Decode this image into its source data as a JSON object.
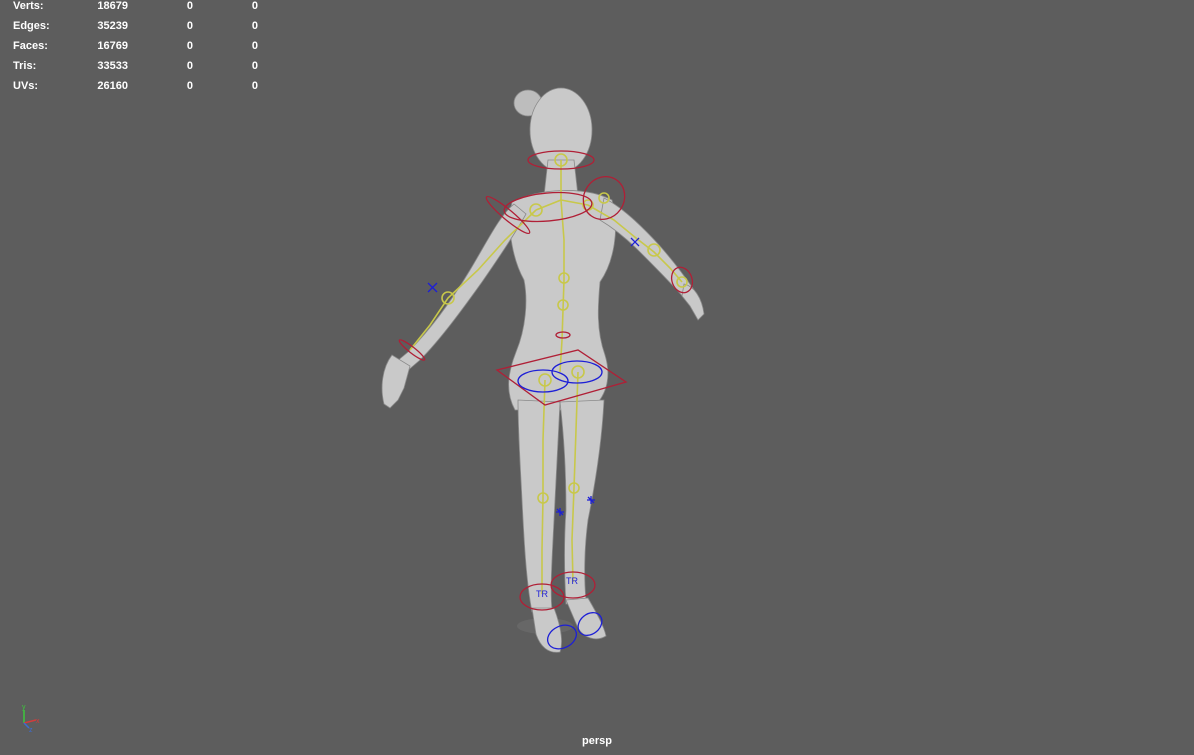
{
  "hud": {
    "rows": [
      {
        "label": "Verts:",
        "values": [
          "18679",
          "0",
          "0"
        ]
      },
      {
        "label": "Edges:",
        "values": [
          "35239",
          "0",
          "0"
        ]
      },
      {
        "label": "Faces:",
        "values": [
          "16769",
          "0",
          "0"
        ]
      },
      {
        "label": "Tris:",
        "values": [
          "33533",
          "0",
          "0"
        ]
      },
      {
        "label": "UVs:",
        "values": [
          "26160",
          "0",
          "0"
        ]
      }
    ]
  },
  "camera": {
    "name": "persp"
  },
  "axis": {
    "x": "x",
    "y": "y",
    "z": "z"
  },
  "rig": {
    "foot_control_labels": [
      "TR",
      "TR"
    ]
  },
  "colors": {
    "background": "#5d5d5d",
    "mesh": "#c9c9c9",
    "joints": "#c8c84a",
    "fk_controls": "#b01f36",
    "ik_controls": "#1d1fd6",
    "hud_text": "#ffffff"
  }
}
